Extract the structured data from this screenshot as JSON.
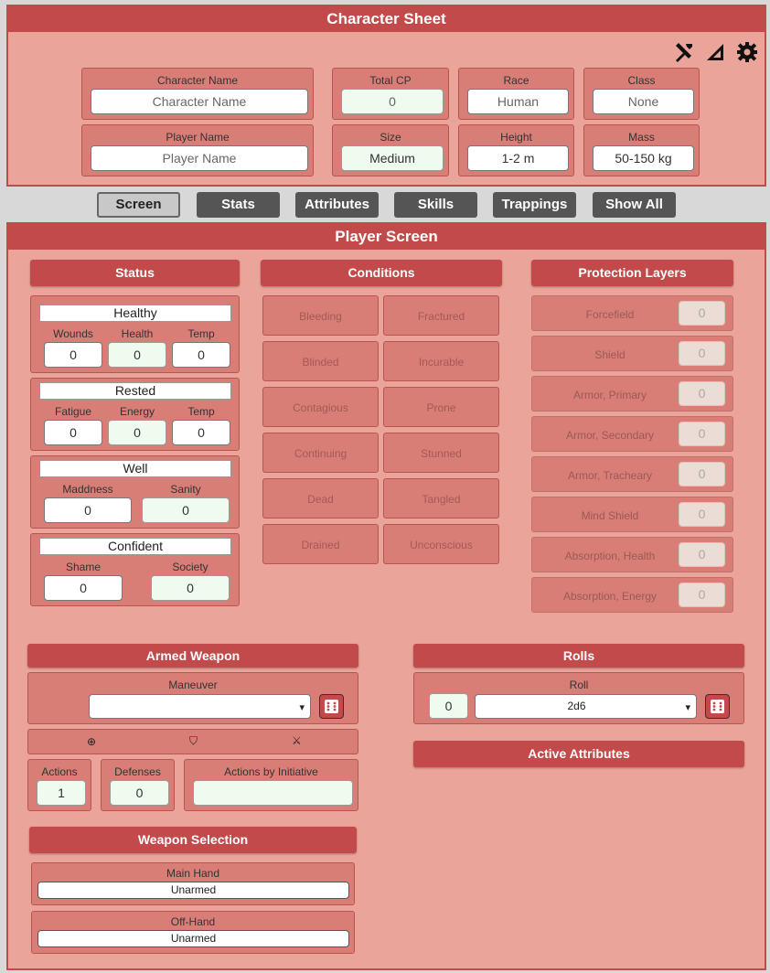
{
  "header": {
    "title": "Character Sheet"
  },
  "toolbar": {
    "icons": [
      "tools-icon",
      "signal-icon",
      "gear-icon"
    ]
  },
  "character": {
    "name": {
      "label": "Character Name",
      "placeholder": "Character Name"
    },
    "total_cp": {
      "label": "Total CP",
      "value": "0"
    },
    "race": {
      "label": "Race",
      "value": "Human"
    },
    "class": {
      "label": "Class",
      "value": "None"
    },
    "player": {
      "label": "Player Name",
      "placeholder": "Player Name"
    },
    "size": {
      "label": "Size",
      "value": "Medium"
    },
    "height": {
      "label": "Height",
      "value": "1-2 m"
    },
    "mass": {
      "label": "Mass",
      "value": "50-150 kg"
    }
  },
  "tabs": [
    "Screen",
    "Stats",
    "Attributes",
    "Skills",
    "Trappings",
    "Show All"
  ],
  "screen": {
    "title": "Player Screen"
  },
  "status": {
    "header": "Status",
    "health": {
      "state": "Healthy",
      "l1": "Wounds",
      "v1": "0",
      "l2": "Health",
      "v2": "0",
      "l3": "Temp",
      "v3": "0"
    },
    "energy": {
      "state": "Rested",
      "l1": "Fatigue",
      "v1": "0",
      "l2": "Energy",
      "v2": "0",
      "l3": "Temp",
      "v3": "0"
    },
    "sanity": {
      "state": "Well",
      "l1": "Maddness",
      "v1": "0",
      "l2": "Sanity",
      "v2": "0"
    },
    "society": {
      "state": "Confident",
      "l1": "Shame",
      "v1": "0",
      "l2": "Society",
      "v2": "0"
    }
  },
  "conditions": {
    "header": "Conditions",
    "items": [
      "Bleeding",
      "Fractured",
      "Blinded",
      "Incurable",
      "Contagious",
      "Prone",
      "Continuing",
      "Stunned",
      "Dead",
      "Tangled",
      "Drained",
      "Unconscious"
    ]
  },
  "protection": {
    "header": "Protection Layers",
    "items": [
      {
        "label": "Forcefield",
        "value": "0"
      },
      {
        "label": "Shield",
        "value": "0"
      },
      {
        "label": "Armor, Primary",
        "value": "0"
      },
      {
        "label": "Armor, Secondary",
        "value": "0"
      },
      {
        "label": "Armor, Tracheary",
        "value": "0"
      },
      {
        "label": "Mind Shield",
        "value": "0"
      },
      {
        "label": "Absorption, Health",
        "value": "0"
      },
      {
        "label": "Absorption, Energy",
        "value": "0"
      }
    ]
  },
  "armed": {
    "header": "Armed Weapon",
    "maneuver_label": "Maneuver",
    "maneuver_value": "",
    "actions_label": "Actions",
    "actions_value": "1",
    "defenses_label": "Defenses",
    "defenses_value": "0",
    "initiative_label": "Actions by Initiative",
    "initiative_value": ""
  },
  "rolls": {
    "header": "Rolls",
    "roll_label": "Roll",
    "roll_count": "0",
    "roll_value": "2d6"
  },
  "active": {
    "header": "Active Attributes"
  },
  "weapons": {
    "header": "Weapon Selection",
    "main_label": "Main Hand",
    "main_value": "Unarmed",
    "off_label": "Off-Hand",
    "off_value": "Unarmed"
  }
}
